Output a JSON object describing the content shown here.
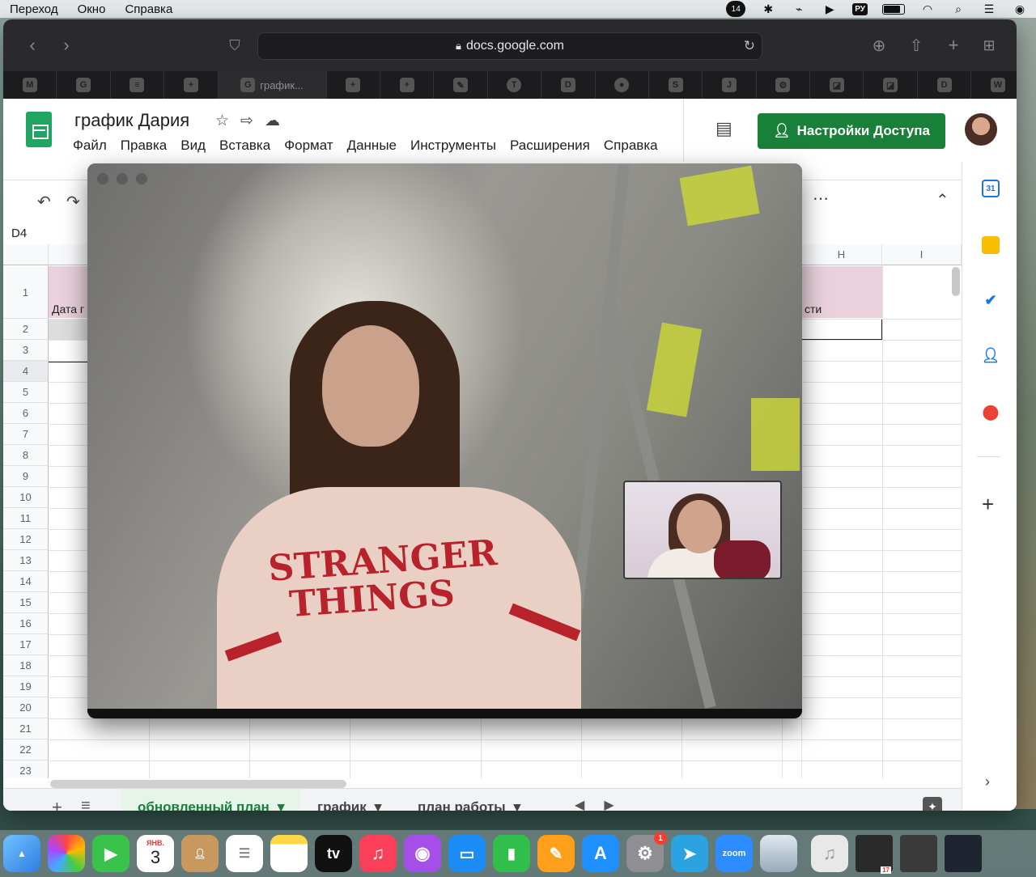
{
  "menubar": {
    "items": [
      "Переход",
      "Окно",
      "Справка"
    ],
    "notification_count": "14",
    "input_source": "РУ"
  },
  "browser": {
    "url": "docs.google.com",
    "active_tab_label": "график...",
    "tab_icons": [
      "gmail-icon",
      "google-icon",
      "docs-icon",
      "sheets-plus-icon",
      "google-active-tab",
      "sheets-plus-icon",
      "sheets-plus-icon",
      "pen-icon",
      "t-icon",
      "d-icon",
      "coin-icon",
      "s-icon",
      "j-icon",
      "gear-outline-icon",
      "slash-icon",
      "slash-icon",
      "d-icon",
      "w-icon"
    ],
    "tab_letters": {
      "google": "G",
      "d": "D",
      "s": "S",
      "j": "J",
      "w": "W"
    }
  },
  "sheets": {
    "title": "график Дария",
    "menu": [
      "Файл",
      "Правка",
      "Вид",
      "Вставка",
      "Формат",
      "Данные",
      "Инструменты",
      "Расширения",
      "Справка"
    ],
    "share_label": "Настройки Доступа",
    "name_box": "D4",
    "columns_visible": [
      "H",
      "I"
    ],
    "rows": [
      "1",
      "2",
      "3",
      "4",
      "5",
      "6",
      "7",
      "8",
      "9",
      "10",
      "11",
      "12",
      "13",
      "14",
      "15",
      "16",
      "17",
      "18",
      "19",
      "20",
      "21",
      "22",
      "23"
    ],
    "cell_a1_partial": "Дата г",
    "cell_h1_partial": "сти",
    "sheet_tabs": [
      "обновленный план",
      "график",
      "план работы"
    ],
    "side_panel": [
      "calendar-icon",
      "keep-icon",
      "tasks-icon",
      "contacts-icon",
      "maps-icon"
    ],
    "calendar_day": "31"
  },
  "video_call": {
    "shirt_text_line1": "STRANGER",
    "shirt_text_line2": "THINGS"
  },
  "dock": {
    "calendar_month": "ЯНВ.",
    "calendar_day": "3",
    "tv_label": "tv",
    "zoom_label": "zoom",
    "settings_badge": "1",
    "small_calendar_day": "17"
  },
  "colors": {
    "sheets_green": "#188038",
    "header_pink": "#ead1dc",
    "browser_dark": "#2a2a2c"
  }
}
